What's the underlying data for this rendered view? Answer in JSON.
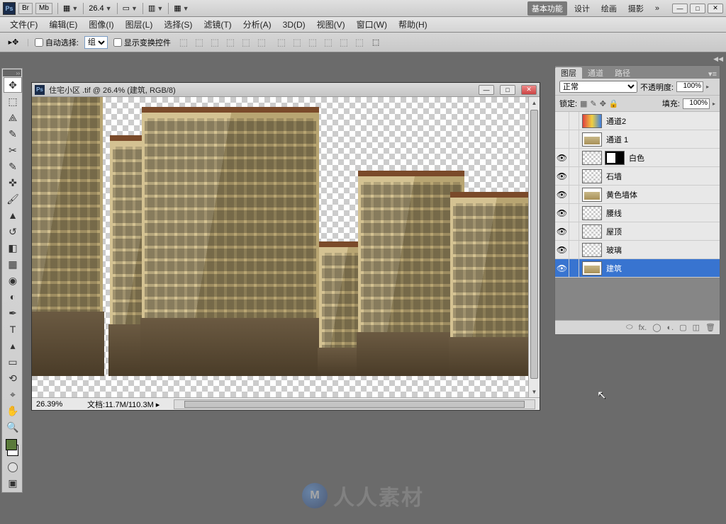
{
  "appbar": {
    "br": "Br",
    "mb": "Mb",
    "zoom": "26.4",
    "arrow": "▼"
  },
  "workspaces": {
    "basic": "基本功能",
    "design": "设计",
    "paint": "绘画",
    "photo": "摄影",
    "more": "»"
  },
  "winbtns": {
    "min": "—",
    "max": "□",
    "close": "✕"
  },
  "menu": {
    "file": "文件(F)",
    "edit": "编辑(E)",
    "image": "图像(I)",
    "layer": "图层(L)",
    "select": "选择(S)",
    "filter": "滤镜(T)",
    "analysis": "分析(A)",
    "3d": "3D(D)",
    "view": "视图(V)",
    "window": "窗口(W)",
    "help": "帮助(H)"
  },
  "options": {
    "autoselect": "自动选择:",
    "group": "组",
    "showtransform": "显示变换控件"
  },
  "doc": {
    "title": "住宅小区 .tif @ 26.4% (建筑, RGB/8)",
    "zoom": "26.39%",
    "docinfo_label": "文档:",
    "docinfo": "11.7M/110.3M"
  },
  "panel": {
    "tabs": {
      "layers": "图层",
      "channels": "通道",
      "paths": "路径"
    },
    "blend": "正常",
    "opacity_label": "不透明度:",
    "opacity": "100%",
    "lock_label": "锁定:",
    "fill_label": "填充:",
    "fill": "100%"
  },
  "layers": [
    {
      "name": "通道2",
      "visible": false,
      "thumb": "color"
    },
    {
      "name": "通道 1",
      "visible": false,
      "thumb": "bldg"
    },
    {
      "name": "白色",
      "visible": true,
      "thumb": "chk",
      "mask": true
    },
    {
      "name": "石墙",
      "visible": true,
      "thumb": "chk"
    },
    {
      "name": "黄色墙体",
      "visible": true,
      "thumb": "bldg"
    },
    {
      "name": "腰线",
      "visible": true,
      "thumb": "chk"
    },
    {
      "name": "屋顶",
      "visible": true,
      "thumb": "chk"
    },
    {
      "name": "玻璃",
      "visible": true,
      "thumb": "chk"
    },
    {
      "name": "建筑",
      "visible": true,
      "thumb": "bldg",
      "selected": true
    }
  ],
  "footicons": {
    "link": "⬭",
    "fx": "fx.",
    "mask": "◯",
    "adj": "◐.",
    "group": "▢",
    "new": "◫",
    "trash": "🗑"
  },
  "watermark": {
    "logo": "M",
    "text": "人人素材"
  }
}
